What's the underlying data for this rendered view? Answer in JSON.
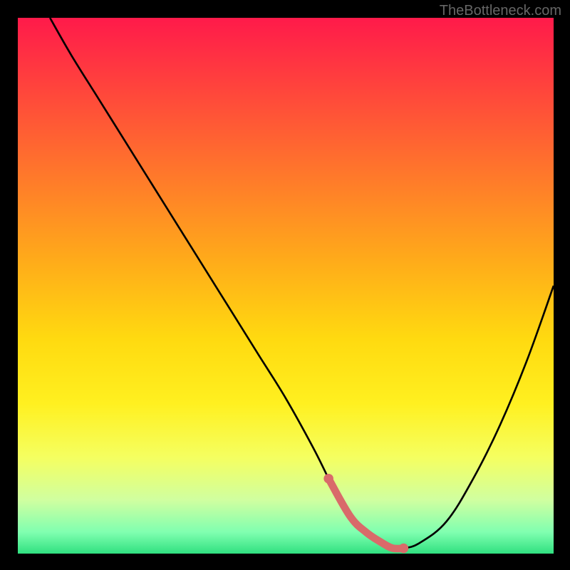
{
  "watermark": "TheBottleneck.com",
  "chart_data": {
    "type": "line",
    "title": "",
    "xlabel": "",
    "ylabel": "",
    "xlim": [
      0,
      100
    ],
    "ylim": [
      0,
      100
    ],
    "gradient_stops": [
      {
        "offset": 0.0,
        "color": "#ff1a4a"
      },
      {
        "offset": 0.05,
        "color": "#ff2a45"
      },
      {
        "offset": 0.15,
        "color": "#ff4a3a"
      },
      {
        "offset": 0.3,
        "color": "#ff7a2a"
      },
      {
        "offset": 0.45,
        "color": "#ffaa1a"
      },
      {
        "offset": 0.6,
        "color": "#ffda10"
      },
      {
        "offset": 0.72,
        "color": "#fff020"
      },
      {
        "offset": 0.82,
        "color": "#f5ff60"
      },
      {
        "offset": 0.9,
        "color": "#d0ffa0"
      },
      {
        "offset": 0.96,
        "color": "#80ffb0"
      },
      {
        "offset": 1.0,
        "color": "#30e080"
      }
    ],
    "series": [
      {
        "name": "bottleneck-curve",
        "color": "#000000",
        "x": [
          6,
          10,
          15,
          20,
          25,
          30,
          35,
          40,
          45,
          50,
          55,
          58,
          60,
          62,
          65,
          68,
          70,
          72,
          75,
          80,
          85,
          90,
          95,
          100
        ],
        "y": [
          100,
          93,
          85,
          77,
          69,
          61,
          53,
          45,
          37,
          29,
          20,
          14,
          10,
          7,
          4,
          2,
          1,
          1,
          2,
          6,
          14,
          24,
          36,
          50
        ]
      }
    ],
    "highlight_segment": {
      "name": "optimal-range",
      "color": "#d96a6a",
      "x": [
        58,
        62,
        65,
        68,
        70,
        72
      ],
      "y": [
        14,
        7,
        4,
        2,
        1,
        1
      ],
      "endpoints": [
        {
          "x": 58,
          "y": 14
        },
        {
          "x": 72,
          "y": 1
        }
      ]
    }
  }
}
